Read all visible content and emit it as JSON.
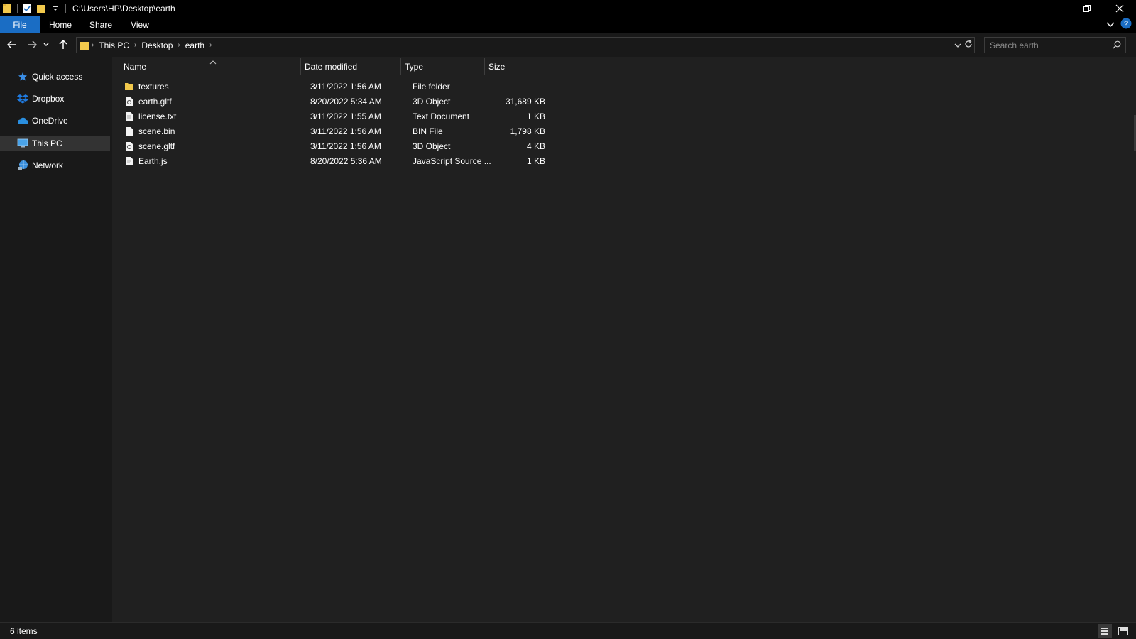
{
  "window": {
    "title": "C:\\Users\\HP\\Desktop\\earth"
  },
  "ribbon": {
    "tabs": [
      {
        "label": "File"
      },
      {
        "label": "Home"
      },
      {
        "label": "Share"
      },
      {
        "label": "View"
      }
    ]
  },
  "address": {
    "crumbs": [
      "This PC",
      "Desktop",
      "earth"
    ]
  },
  "search": {
    "placeholder": "Search earth"
  },
  "sidebar": {
    "items": [
      {
        "label": "Quick access",
        "icon": "star-icon"
      },
      {
        "label": "Dropbox",
        "icon": "dropbox-icon"
      },
      {
        "label": "OneDrive",
        "icon": "cloud-icon"
      },
      {
        "label": "This PC",
        "icon": "computer-icon",
        "selected": true
      },
      {
        "label": "Network",
        "icon": "network-icon"
      }
    ]
  },
  "columns": {
    "name": "Name",
    "date": "Date modified",
    "type": "Type",
    "size": "Size"
  },
  "files": [
    {
      "name": "textures",
      "date": "3/11/2022 1:56 AM",
      "type": "File folder",
      "size": "",
      "icon": "folder-icon"
    },
    {
      "name": "earth.gltf",
      "date": "8/20/2022 5:34 AM",
      "type": "3D Object",
      "size": "31,689 KB",
      "icon": "3d-object-icon"
    },
    {
      "name": "license.txt",
      "date": "3/11/2022 1:55 AM",
      "type": "Text Document",
      "size": "1 KB",
      "icon": "text-file-icon"
    },
    {
      "name": "scene.bin",
      "date": "3/11/2022 1:56 AM",
      "type": "BIN File",
      "size": "1,798 KB",
      "icon": "file-icon"
    },
    {
      "name": "scene.gltf",
      "date": "3/11/2022 1:56 AM",
      "type": "3D Object",
      "size": "4 KB",
      "icon": "3d-object-icon"
    },
    {
      "name": "Earth.js",
      "date": "8/20/2022 5:36 AM",
      "type": "JavaScript Source ...",
      "size": "1 KB",
      "icon": "js-file-icon"
    }
  ],
  "status": {
    "count": "6 items"
  },
  "colors": {
    "accent": "#1a6dc4",
    "folder": "#f2c94c",
    "background": "#202020"
  }
}
